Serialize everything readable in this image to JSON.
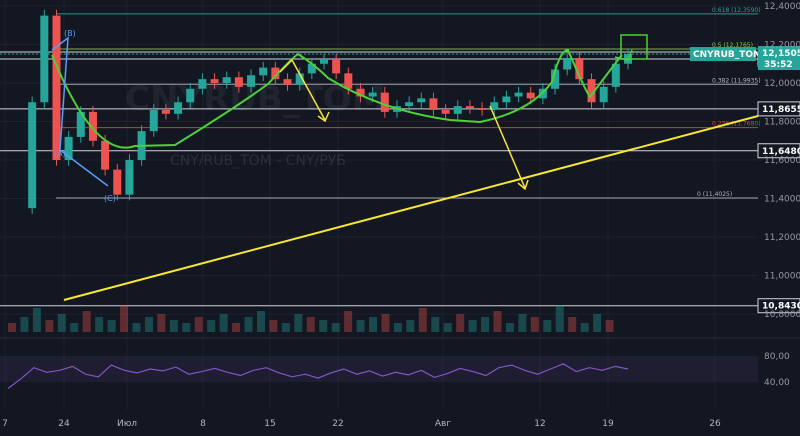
{
  "chart_data": {
    "type": "candlestick",
    "symbol": "CNYRUB_TOM",
    "watermark": "CNY/RUB_TOM - CNY/РУБ",
    "y_range": [
      10.8,
      12.4
    ],
    "price_ticks": [
      "12,4000",
      "12,2000",
      "12,0000",
      "11,8000",
      "11,6000",
      "11,4000",
      "11,2000",
      "11,0000",
      "10,8000"
    ],
    "x_ticks": [
      "7",
      "24",
      "Июл",
      "8",
      "15",
      "22",
      "Авг",
      "12",
      "19",
      "26"
    ],
    "current_price": {
      "value": "12,1505",
      "label": "CNYRUB_TOM",
      "countdown": "35:52"
    },
    "horizontal_levels": [
      "12,1245",
      "11,8655",
      "11,6480",
      "10,8430"
    ],
    "fib_levels": [
      {
        "label": "0.618 (12,3590)",
        "value": 12.359,
        "color": "#26a69a"
      },
      {
        "label": "0.5 (12,1765)",
        "value": 12.1765,
        "color": "#8bc34a"
      },
      {
        "label": "0.382 (11,9935)",
        "value": 11.9935,
        "color": "#b2b5be"
      },
      {
        "label": "0.236 (11,7680)",
        "value": 11.768,
        "color": "#f23645"
      },
      {
        "label": "0 (11,4025)",
        "value": 11.4025,
        "color": "#b2b5be"
      }
    ],
    "wave_labels": [
      "(B)",
      "(A)",
      "(C)"
    ],
    "series": [
      {
        "name": "price",
        "values": [
          11.35,
          11.9,
          12.35,
          11.6,
          11.72,
          11.85,
          11.7,
          11.55,
          11.42,
          11.6,
          11.75,
          11.86,
          11.84,
          11.9,
          11.97,
          12.02,
          12.0,
          12.03,
          11.98,
          12.04,
          12.08,
          12.02,
          11.99,
          12.05,
          12.1,
          12.12,
          12.05,
          11.97,
          11.93,
          11.95,
          11.85,
          11.88,
          11.9,
          11.92,
          11.86,
          11.84,
          11.88,
          11.87,
          11.86,
          11.9,
          11.93,
          11.95,
          11.92,
          11.97,
          12.07,
          12.13,
          12.02,
          11.9,
          11.98,
          12.1,
          12.15
        ]
      }
    ],
    "rsi": {
      "ticks": [
        "80,00",
        "40,00"
      ],
      "values": [
        30,
        45,
        62,
        55,
        58,
        64,
        52,
        48,
        66,
        58,
        54,
        60,
        57,
        63,
        52,
        56,
        61,
        55,
        50,
        58,
        62,
        54,
        48,
        52,
        46,
        54,
        60,
        52,
        57,
        49,
        55,
        51,
        58,
        47,
        53,
        61,
        56,
        50,
        62,
        66,
        58,
        52,
        60,
        68,
        56,
        62,
        58,
        64,
        60
      ]
    },
    "volume": [
      3,
      5,
      8,
      4,
      6,
      3,
      7,
      5,
      4,
      9,
      3,
      5,
      6,
      4,
      3,
      5,
      4,
      6,
      3,
      5,
      7,
      4,
      3,
      6,
      5,
      4,
      3,
      7,
      4,
      5,
      6,
      3,
      4,
      8,
      5,
      3,
      6,
      4,
      5,
      7,
      3,
      6,
      5,
      4,
      9,
      5,
      3,
      6,
      4
    ],
    "colors": {
      "up": "#26a69a",
      "down": "#ef5350",
      "trend_green": "#4cd137",
      "arrow_yellow": "#f7e733",
      "rsi": "#7e57c2"
    }
  }
}
